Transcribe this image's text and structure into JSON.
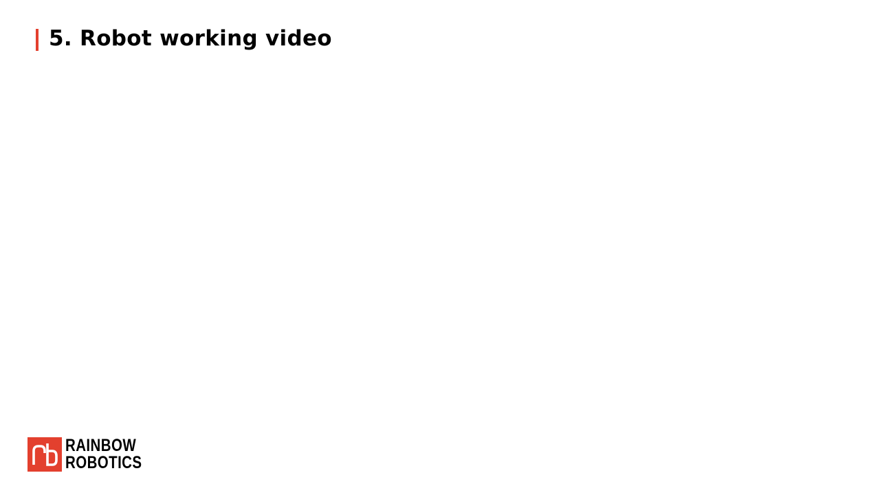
{
  "slide": {
    "title": "5. Robot working video",
    "accent_color": "#e3402e"
  },
  "logo": {
    "icon": "rainbow-robotics-rb-logo-icon",
    "line1": "RAINBOW",
    "line2": "ROBOTICS",
    "brand_color": "#e3402e"
  }
}
